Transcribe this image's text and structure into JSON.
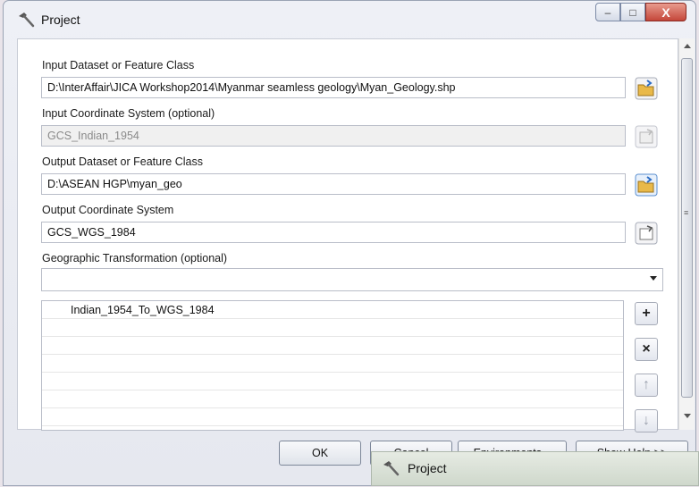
{
  "window": {
    "title": "Project",
    "buttons": {
      "minimize": "–",
      "maximize": "□",
      "close": "X"
    }
  },
  "fields": {
    "input_dataset": {
      "label": "Input Dataset or Feature Class",
      "value": "D:\\InterAffair\\JICA Workshop2014\\Myanmar seamless geology\\Myan_Geology.shp"
    },
    "input_cs": {
      "label": "Input Coordinate System (optional)",
      "value": "GCS_Indian_1954"
    },
    "output_dataset": {
      "label": "Output Dataset or Feature Class",
      "value": "D:\\ASEAN HGP\\myan_geo"
    },
    "output_cs": {
      "label": "Output Coordinate System",
      "value": "GCS_WGS_1984"
    },
    "geo_transform": {
      "label": "Geographic Transformation (optional)",
      "selected": ""
    }
  },
  "transform_list": {
    "items": [
      "Indian_1954_To_WGS_1984",
      "",
      "",
      "",
      "",
      "",
      ""
    ],
    "side_buttons": {
      "add": "+",
      "remove": "×",
      "up": "↑",
      "down": "↓"
    }
  },
  "footer": {
    "ok": "OK",
    "cancel": "Cancel",
    "environments": "Environments...",
    "show_help": "Show Help >>"
  },
  "taskbar": {
    "label": "Project"
  },
  "colors": {
    "accent": "#2b6cc4",
    "folder": "#e9b949"
  }
}
